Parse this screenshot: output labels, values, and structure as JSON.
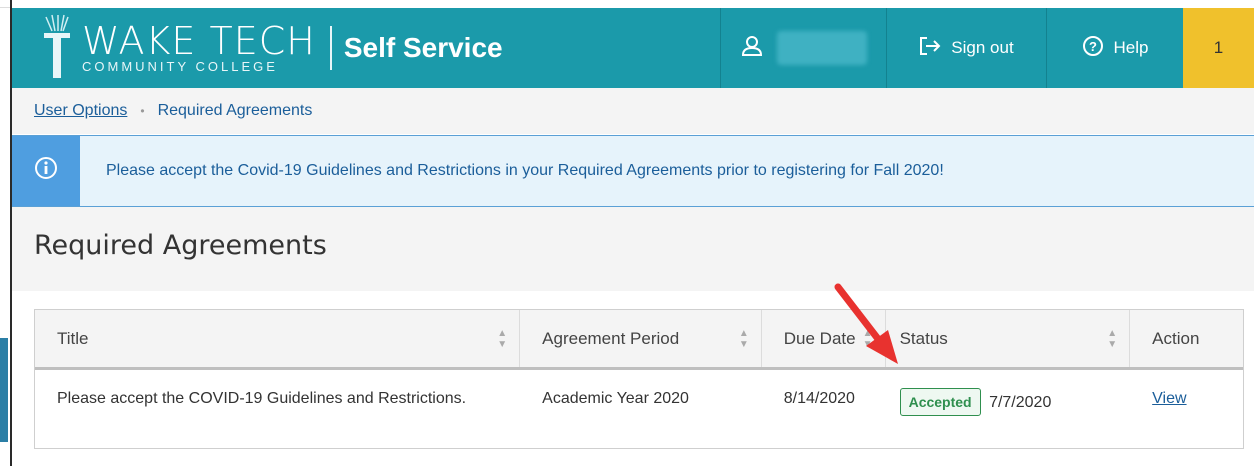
{
  "header": {
    "logo_main": "WAKE TECH",
    "logo_sub": "COMMUNITY COLLEGE",
    "app_name": "Self Service",
    "sign_out_label": "Sign out",
    "help_label": "Help",
    "notification_count": "1"
  },
  "breadcrumb": {
    "items": [
      "User Options",
      "Required Agreements"
    ],
    "separator": "•"
  },
  "banner": {
    "message": "Please accept the Covid-19 Guidelines and Restrictions in your Required Agreements prior to registering for Fall 2020!"
  },
  "page": {
    "title": "Required Agreements"
  },
  "table": {
    "columns": [
      "Title",
      "Agreement Period",
      "Due Date",
      "Status",
      "Action"
    ],
    "rows": [
      {
        "title": "Please accept the COVID-19 Guidelines and Restrictions.",
        "period": "Academic Year 2020",
        "due_date": "8/14/2020",
        "status_badge": "Accepted",
        "status_date": "7/7/2020",
        "action": "View"
      }
    ]
  },
  "colors": {
    "header_bg": "#1b9aaa",
    "notify_bg": "#f0c12c",
    "link": "#1b5e9a",
    "accepted": "#2f8f4e",
    "annotation_arrow": "#e8322f"
  },
  "icons": {
    "user": "user-icon",
    "sign_out": "sign-out-icon",
    "help": "help-icon",
    "info": "info-icon",
    "sort": "sort-icon"
  }
}
